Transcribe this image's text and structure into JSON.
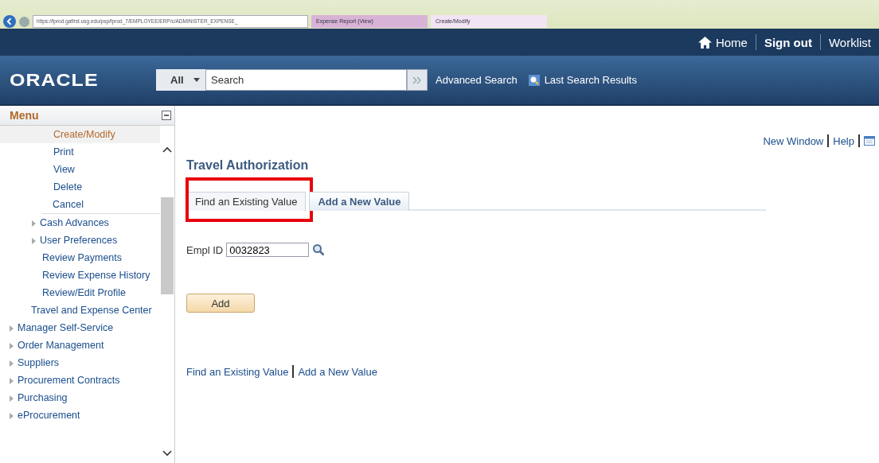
{
  "browser": {
    "address": "https://fprod.gafirst.usg.edu/psp/fprod_7/EMPLOYEE/ERP/c/ADMINISTER_EXPENSE_",
    "tabs": [
      {
        "label": "Expense Report (View)",
        "selected": false
      },
      {
        "label": "Create/Modify",
        "selected": true
      }
    ]
  },
  "header": {
    "links": [
      {
        "label": "Home",
        "kind": "home"
      },
      {
        "label": "Sign out",
        "kind": "bold"
      },
      {
        "label": "Worklist",
        "kind": "plain"
      }
    ],
    "logo": "ORACLE",
    "search": {
      "scope": "All",
      "placeholder": "Search"
    },
    "advanced_search": "Advanced Search",
    "last_results": "Last Search Results"
  },
  "menu": {
    "title": "Menu",
    "items": [
      {
        "children": [
          {
            "children": [
              {
                "children": [
                  {
                    "label": "Create/Modify",
                    "selected": true
                  },
                  {
                    "label": "Print",
                    "selected": false
                  },
                  {
                    "label": "View",
                    "selected": false
                  },
                  {
                    "label": "Delete",
                    "selected": false
                  },
                  {
                    "label": "Cancel",
                    "selected": false
                  }
                ]
              },
              {
                "label": "Cash Advances",
                "selected": false,
                "expanded": false
              },
              {
                "label": "User Preferences",
                "selected": false,
                "expanded": false
              },
              {
                "label": "Review Payments",
                "selected": false
              },
              {
                "label": "Review Expense History",
                "selected": false
              },
              {
                "label": "Review/Edit Profile",
                "selected": false
              }
            ]
          },
          {
            "label": "Travel and Expense Center",
            "selected": false
          }
        ]
      },
      {
        "label": "Manager Self-Service",
        "selected": false,
        "expanded": false
      },
      {
        "label": "Order Management",
        "selected": false,
        "expanded": false
      },
      {
        "label": "Suppliers",
        "selected": false,
        "expanded": false
      },
      {
        "label": "Procurement Contracts",
        "selected": false,
        "expanded": false
      },
      {
        "label": "Purchasing",
        "selected": false,
        "expanded": false
      },
      {
        "label": "eProcurement",
        "selected": false,
        "expanded": false
      }
    ]
  },
  "page": {
    "links": [
      "New Window",
      "Help"
    ],
    "title": "Travel Authorization",
    "tabs": [
      {
        "label": "Find an Existing Value",
        "selected": false,
        "highlighted": true
      },
      {
        "label": "Add a New Value",
        "selected": true,
        "highlighted": false
      }
    ],
    "field": {
      "label": "Empl ID",
      "value": "0032823"
    },
    "button": "Add",
    "bottom_links": [
      "Find an Existing Value",
      "Add a New Value"
    ]
  }
}
